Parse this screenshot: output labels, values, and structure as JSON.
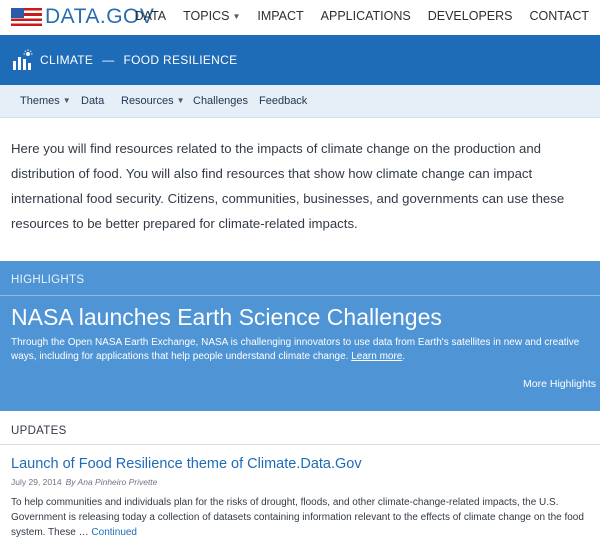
{
  "header": {
    "logo_text": "DATA.GOV",
    "nav": [
      {
        "label": "DATA"
      },
      {
        "label": "TOPICS",
        "has_caret": true
      },
      {
        "label": "IMPACT"
      },
      {
        "label": "APPLICATIONS"
      },
      {
        "label": "DEVELOPERS"
      },
      {
        "label": "CONTACT"
      }
    ]
  },
  "topic": {
    "category": "CLIMATE",
    "separator": "—",
    "name": "FOOD RESILIENCE",
    "icon": "bar-chart-sparkle-icon"
  },
  "subnav": [
    {
      "label": "Themes",
      "has_caret": true
    },
    {
      "label": "Data"
    },
    {
      "label": "Resources",
      "has_caret": true
    },
    {
      "label": "Challenges"
    },
    {
      "label": "Feedback"
    }
  ],
  "intro": "Here you will find resources related to the impacts of climate change on the production and distribution of food. You will also find resources that show how climate change can impact international food security. Citizens, communities, businesses, and governments can use these resources to be better prepared for climate-related impacts.",
  "highlights": {
    "label": "HIGHLIGHTS",
    "title": "NASA launches Earth Science Challenges",
    "body": "Through the Open NASA Earth Exchange, NASA is challenging innovators to use data from Earth's satellites in new and creative ways, including for applications that help people understand climate change.",
    "link": "Learn more",
    "link_suffix": ".",
    "more": "More Highlights"
  },
  "updates": {
    "label": "UPDATES",
    "title": "Launch of Food Resilience theme of Climate.Data.Gov",
    "date": "July 29, 2014",
    "author": "By Ana Pinheiro Privette",
    "body": "To help communities and individuals plan for the risks of drought, floods, and other climate-change-related impacts, the U.S. Government is releasing today a collection of datasets containing information relevant to the effects of climate change on the food system. These …",
    "continue": "Continued"
  },
  "colors": {
    "brand_blue": "#1e6bb8",
    "highlight_blue": "#4f94d4",
    "subnav_bg": "#e6eef7"
  }
}
